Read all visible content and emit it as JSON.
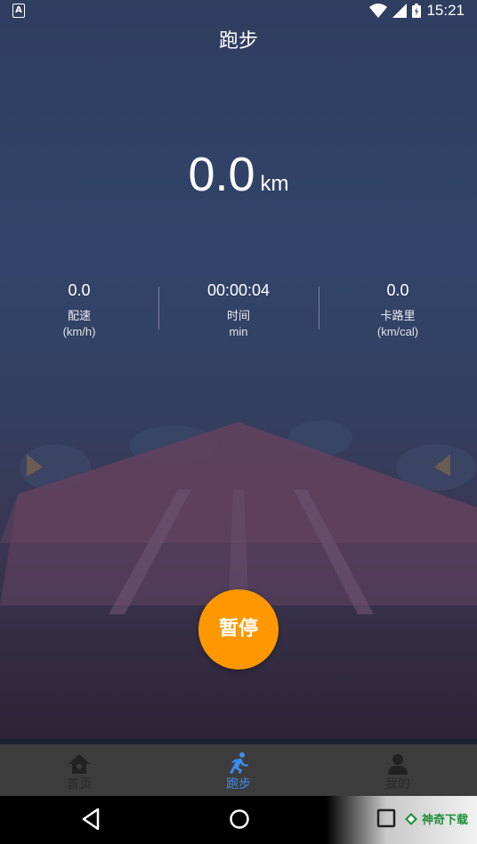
{
  "status_bar": {
    "time": "15:21"
  },
  "header": {
    "title": "跑步"
  },
  "distance": {
    "value": "0.0",
    "unit": "km"
  },
  "stats": [
    {
      "value": "0.0",
      "label": "配速",
      "unit": "(km/h)"
    },
    {
      "value": "00:00:04",
      "label": "时间",
      "unit": "min"
    },
    {
      "value": "0.0",
      "label": "卡路里",
      "unit": "(km/cal)"
    }
  ],
  "pause_button": {
    "label": "暂停"
  },
  "tabs": [
    {
      "label": "首页",
      "icon": "home-icon",
      "active": false
    },
    {
      "label": "跑步",
      "icon": "running-person-icon",
      "active": true
    },
    {
      "label": "我的",
      "icon": "profile-icon",
      "active": false
    }
  ],
  "watermark": {
    "text": "神奇下载"
  },
  "colors": {
    "accent": "#ff9800",
    "active_tab": "#3c8cf0",
    "background_top": "#2f3e5f",
    "background_bottom": "#2c2436"
  }
}
